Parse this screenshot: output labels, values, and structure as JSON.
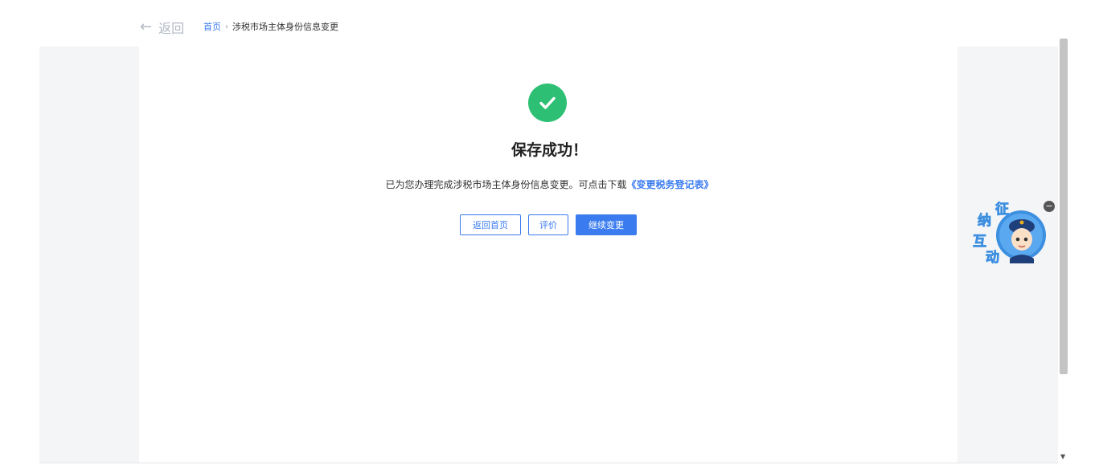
{
  "header": {
    "back_label": "返回",
    "breadcrumb": {
      "home": "首页",
      "separator": "›",
      "current": "涉税市场主体身份信息变更"
    }
  },
  "result": {
    "title": "保存成功！",
    "message": "已为您办理完成涉税市场主体身份信息变更。可点击下载",
    "download_link": "《变更税务登记表》"
  },
  "buttons": {
    "return_home": "返回首页",
    "evaluate": "评价",
    "continue_change": "继续变更"
  },
  "widget": {
    "chars": [
      "征",
      "纳",
      "互",
      "动"
    ],
    "close_symbol": "−"
  },
  "colors": {
    "accent": "#3a7bf0",
    "success": "#2dbf73",
    "side_bg": "#f4f5f7"
  },
  "icons": [
    "back-arrow-icon",
    "success-check-icon",
    "scroll-down-icon"
  ]
}
